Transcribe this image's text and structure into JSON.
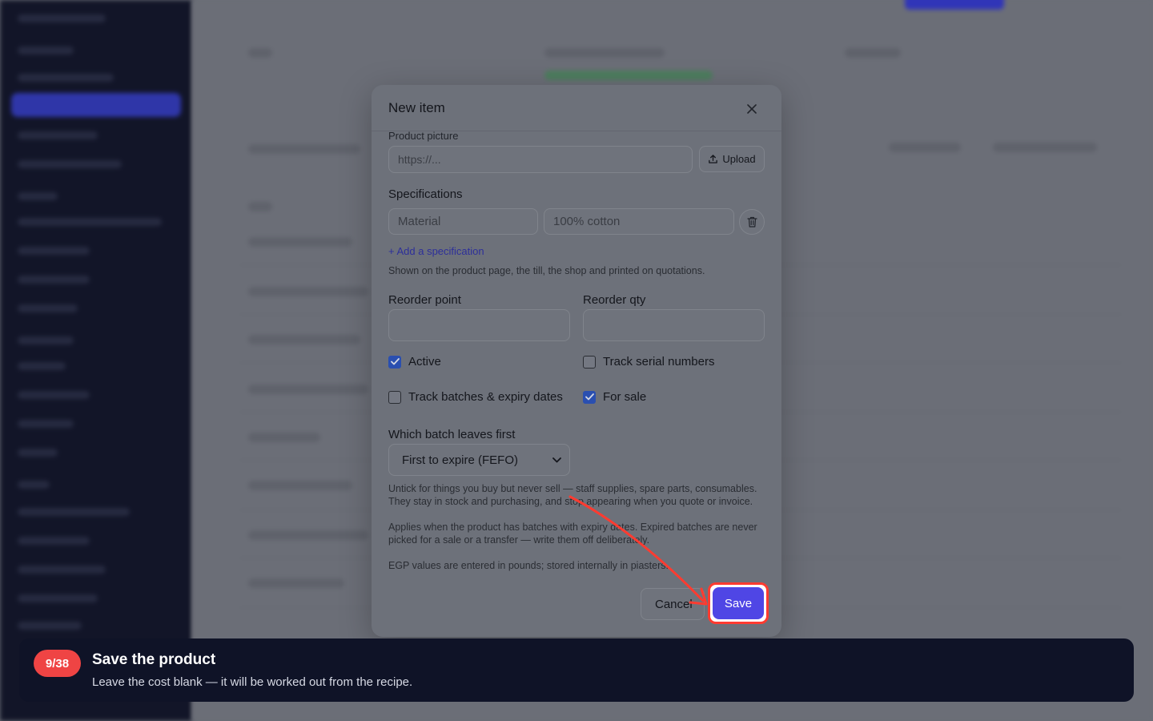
{
  "modal": {
    "title": "New item",
    "product_picture": {
      "label": "Product picture",
      "placeholder": "https://...",
      "upload_label": "Upload"
    },
    "specifications": {
      "label": "Specifications",
      "name_placeholder": "Material",
      "value_placeholder": "100% cotton",
      "add_link": "+ Add a specification",
      "help": "Shown on the product page, the till, the shop and printed on quotations."
    },
    "reorder_point": {
      "label": "Reorder point",
      "value": ""
    },
    "reorder_qty": {
      "label": "Reorder qty",
      "value": ""
    },
    "checkboxes": {
      "active": {
        "label": "Active",
        "checked": true
      },
      "track_serial": {
        "label": "Track serial numbers",
        "checked": false
      },
      "track_batches": {
        "label": "Track batches & expiry dates",
        "checked": false
      },
      "for_sale": {
        "label": "For sale",
        "checked": true
      }
    },
    "batch_order": {
      "label": "Which batch leaves first",
      "selected": "First to expire (FEFO)"
    },
    "help_texts": [
      "Untick for things you buy but never sell — staff supplies, spare parts, consumables. They stay in stock and purchasing, and stop appearing when you quote or invoice.",
      "Applies when the product has batches with expiry dates. Expired batches are never picked for a sale or a transfer — write them off deliberately.",
      "EGP values are entered in pounds; stored internally in piasters."
    ],
    "cancel_label": "Cancel",
    "save_label": "Save"
  },
  "tour": {
    "step": "9/38",
    "title": "Save the product",
    "description": "Leave the cost blank — it will be worked out from the recipe."
  },
  "colors": {
    "accent": "#4f46e5",
    "highlight": "#ff3b30",
    "tour_bg": "#0f1327",
    "badge": "#ef4444"
  }
}
